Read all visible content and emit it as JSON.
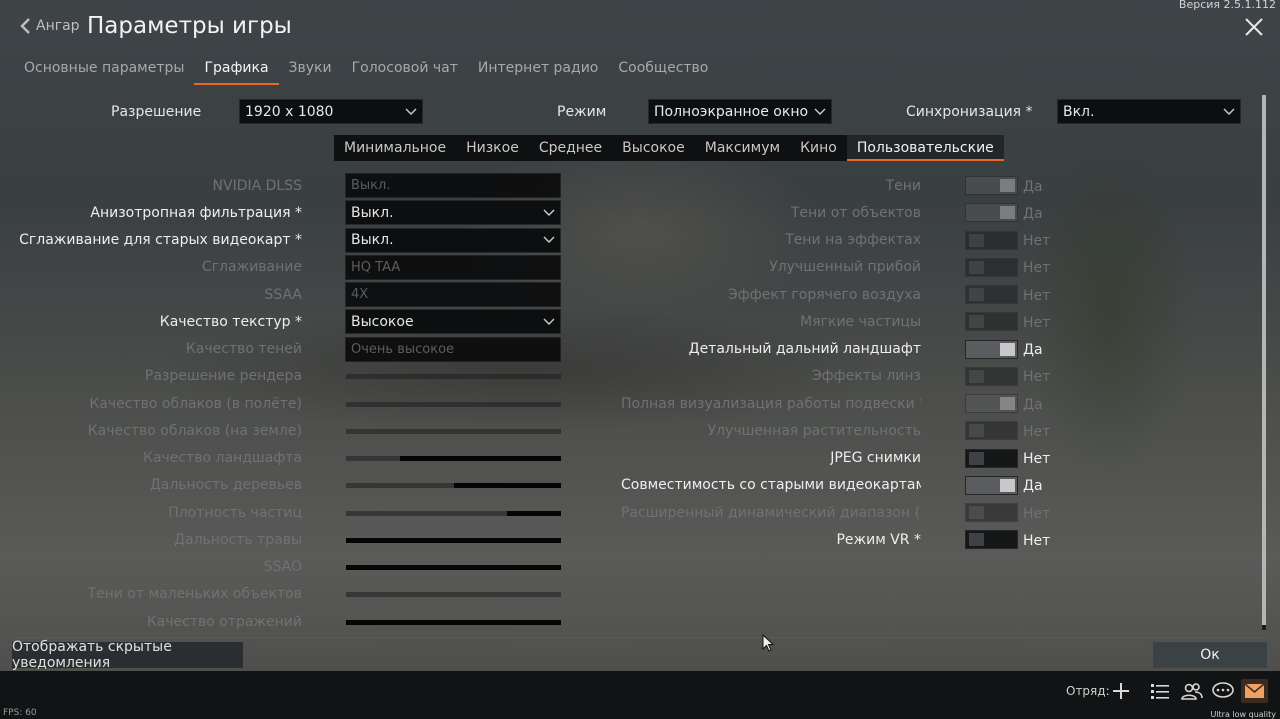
{
  "header": {
    "back_label": "Ангар",
    "separator": "|",
    "title": "Параметры игры",
    "version": "Версия 2.5.1.112"
  },
  "tabs": [
    "Основные параметры",
    "Графика",
    "Звуки",
    "Голосовой чат",
    "Интернет радио",
    "Сообщество"
  ],
  "active_tab": "Графика",
  "top_settings": {
    "resolution": {
      "label": "Разрешение",
      "value": "1920 x 1080"
    },
    "mode": {
      "label": "Режим",
      "value": "Полноэкранное окно"
    },
    "sync": {
      "label": "Синхронизация *",
      "value": "Вкл."
    }
  },
  "presets": [
    "Минимальное",
    "Низкое",
    "Среднее",
    "Высокое",
    "Максимум",
    "Кино",
    "Пользовательские"
  ],
  "active_preset": "Пользовательские",
  "left_settings": [
    {
      "label": "NVIDIA DLSS",
      "type": "field",
      "value": "Выкл.",
      "enabled": false
    },
    {
      "label": "Анизотропная фильтрация *",
      "type": "dropdown",
      "value": "Выкл.",
      "enabled": true
    },
    {
      "label": "Сглаживание для старых видеокарт *",
      "type": "dropdown",
      "value": "Выкл.",
      "enabled": true
    },
    {
      "label": "Сглаживание",
      "type": "field",
      "value": "HQ TAA",
      "enabled": false
    },
    {
      "label": "SSAA",
      "type": "field",
      "value": "4X",
      "enabled": false
    },
    {
      "label": "Качество текстур *",
      "type": "dropdown",
      "value": "Высокое",
      "enabled": true
    },
    {
      "label": "Качество теней",
      "type": "field",
      "value": "Очень высокое",
      "enabled": false
    },
    {
      "label": "Разрешение рендера",
      "type": "slider",
      "value": 0.0,
      "enabled": false
    },
    {
      "label": "Качество облаков (в полёте)",
      "type": "slider",
      "value": 0.0,
      "enabled": false
    },
    {
      "label": "Качество облаков (на земле)",
      "type": "slider",
      "value": 0.0,
      "enabled": false
    },
    {
      "label": "Качество ландшафта",
      "type": "slider",
      "value": 0.75,
      "enabled": false
    },
    {
      "label": "Дальность деревьев",
      "type": "slider",
      "value": 0.5,
      "enabled": false
    },
    {
      "label": "Плотность частиц",
      "type": "slider",
      "value": 0.25,
      "enabled": false
    },
    {
      "label": "Дальность травы",
      "type": "slider",
      "value": 1.0,
      "enabled": false
    },
    {
      "label": "SSAO",
      "type": "slider",
      "value": 1.0,
      "enabled": false
    },
    {
      "label": "Тени от маленьких объектов",
      "type": "slider",
      "value": 0.0,
      "enabled": false
    },
    {
      "label": "Качество отражений",
      "type": "slider",
      "value": 1.0,
      "enabled": false
    }
  ],
  "right_settings": [
    {
      "label": "Тени",
      "on": true,
      "value": "Да",
      "enabled": false
    },
    {
      "label": "Тени от объектов",
      "on": true,
      "value": "Да",
      "enabled": false
    },
    {
      "label": "Тени на эффектах",
      "on": false,
      "value": "Нет",
      "enabled": false
    },
    {
      "label": "Улучшенный прибой",
      "on": false,
      "value": "Нет",
      "enabled": false
    },
    {
      "label": "Эффект горячего воздуха",
      "on": false,
      "value": "Нет",
      "enabled": false
    },
    {
      "label": "Мягкие частицы",
      "on": false,
      "value": "Нет",
      "enabled": false
    },
    {
      "label": "Детальный дальний ландшафт",
      "on": true,
      "value": "Да",
      "enabled": true
    },
    {
      "label": "Эффекты линз",
      "on": false,
      "value": "Нет",
      "enabled": false
    },
    {
      "label": "Полная визуализация работы подвески *",
      "on": true,
      "value": "Да",
      "enabled": false
    },
    {
      "label": "Улучшенная растительность",
      "on": false,
      "value": "Нет",
      "enabled": false
    },
    {
      "label": "JPEG снимки",
      "on": false,
      "value": "Нет",
      "enabled": true
    },
    {
      "label": "Совместимость со старыми видеокартами *",
      "on": true,
      "value": "Да",
      "enabled": true
    },
    {
      "label": "Расширенный динамический диапазон (HDR)",
      "on": false,
      "value": "Нет",
      "enabled": false
    },
    {
      "label": "Режим VR *",
      "on": false,
      "value": "Нет",
      "enabled": true
    }
  ],
  "footer": {
    "hidden_notifications": "Отображать скрытые уведомления",
    "ok": "Ок",
    "squad": "Отряд:",
    "fps": "FPS: 60",
    "quality": "Ultra low quality"
  },
  "colors": {
    "accent": "#e8682c",
    "mail": "#f0a060"
  }
}
